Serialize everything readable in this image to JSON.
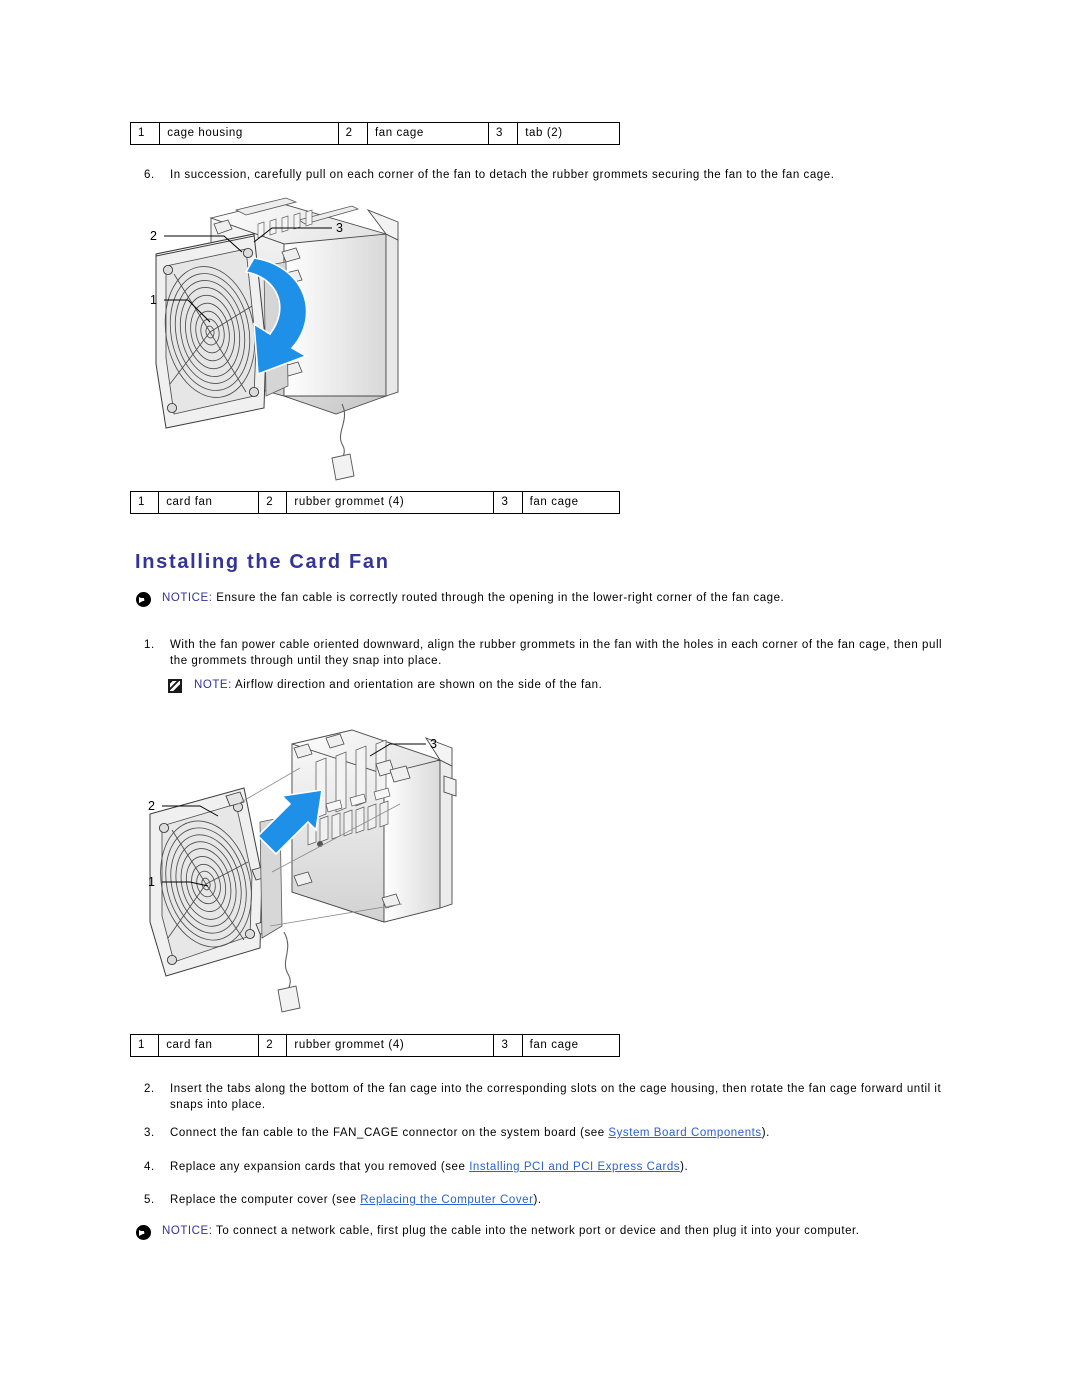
{
  "document": {
    "title": "Installing the Card Fan",
    "heading_color": "#333399",
    "link_color": "#2a61d0",
    "arrow_color": "#1e90e8"
  },
  "tables": [
    {
      "name": "fan-cage-callout-table",
      "rows": [
        [
          {
            "num": "1",
            "label": "cage housing"
          },
          {
            "num": "2",
            "label": "fan cage"
          },
          {
            "num": "3",
            "label": "tab (2)"
          }
        ]
      ]
    },
    {
      "name": "card-fan-removal-callout-table",
      "rows": [
        [
          {
            "num": "1",
            "label": "card fan"
          },
          {
            "num": "2",
            "label": "rubber grommet (4)"
          },
          {
            "num": "3",
            "label": "fan cage"
          }
        ]
      ]
    },
    {
      "name": "card-fan-install-callout-table",
      "rows": [
        [
          {
            "num": "1",
            "label": "card fan"
          },
          {
            "num": "2",
            "label": "rubber grommet (4)"
          },
          {
            "num": "3",
            "label": "fan cage"
          }
        ]
      ]
    }
  ],
  "steps_removal": [
    {
      "marker": "6.",
      "text": "In succession, carefully pull on each corner of the fan to detach the rubber grommets securing the fan to the fan cage."
    }
  ],
  "notice_top": {
    "label": "NOTICE:",
    "text": " Ensure the fan cable is correctly routed through the opening in the lower-right corner of the fan cage."
  },
  "step_install_1": {
    "marker": "1.",
    "text": "With the fan power cable oriented downward, align the rubber grommets in the fan with the holes in each corner of the fan cage, then pull the grommets through until they snap into place."
  },
  "note_airflow": {
    "label": "NOTE:",
    "text": " Airflow direction and orientation are shown on the side of the fan."
  },
  "steps_install": [
    {
      "marker": "2.",
      "prefix": "Insert the tabs along the bottom of the fan cage into the corresponding slots on the cage housing, then rotate the fan cage forward until it snaps into place.",
      "link": "",
      "suffix": ""
    },
    {
      "marker": "3.",
      "prefix": "Connect the fan cable to the FAN_CAGE connector on the system board (see ",
      "link": "System Board Components",
      "suffix": ")."
    },
    {
      "marker": "4.",
      "prefix": "Replace any expansion cards that you removed (see ",
      "link": "Installing PCI and PCI Express Cards",
      "suffix": ")."
    },
    {
      "marker": "5.",
      "prefix": "Replace the computer cover (see ",
      "link": "Replacing the Computer Cover",
      "suffix": ")."
    }
  ],
  "notice_bottom": {
    "label": "NOTICE:",
    "text": " To connect a network cable, first plug the cable into the network port or device and then plug it into your computer."
  },
  "figures": [
    {
      "name": "card-fan-removal-illustration",
      "callouts": [
        "2",
        "3",
        "1"
      ],
      "description": "Exploded view of card fan being rotated away from the fan cage with a curved blue arrow"
    },
    {
      "name": "card-fan-installation-illustration",
      "callouts": [
        "3",
        "2",
        "1"
      ],
      "description": "Exploded view of card fan aligned with the fan cage with a straight blue arrow indicating insertion"
    }
  ]
}
